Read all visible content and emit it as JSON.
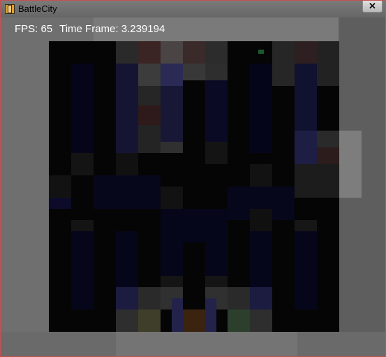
{
  "window": {
    "title": "BattleCity",
    "close_glyph": "✕",
    "icon": "film-clapper-icon"
  },
  "hud": {
    "fps_label": "FPS: 65",
    "time_frame_label": "Time Frame: 3.239194"
  },
  "colors": {
    "window_border": "#c85050",
    "background": "#6f6f6f",
    "board": "#050505",
    "brick": "#0a0a20",
    "hud_text": "#ffffff"
  }
}
